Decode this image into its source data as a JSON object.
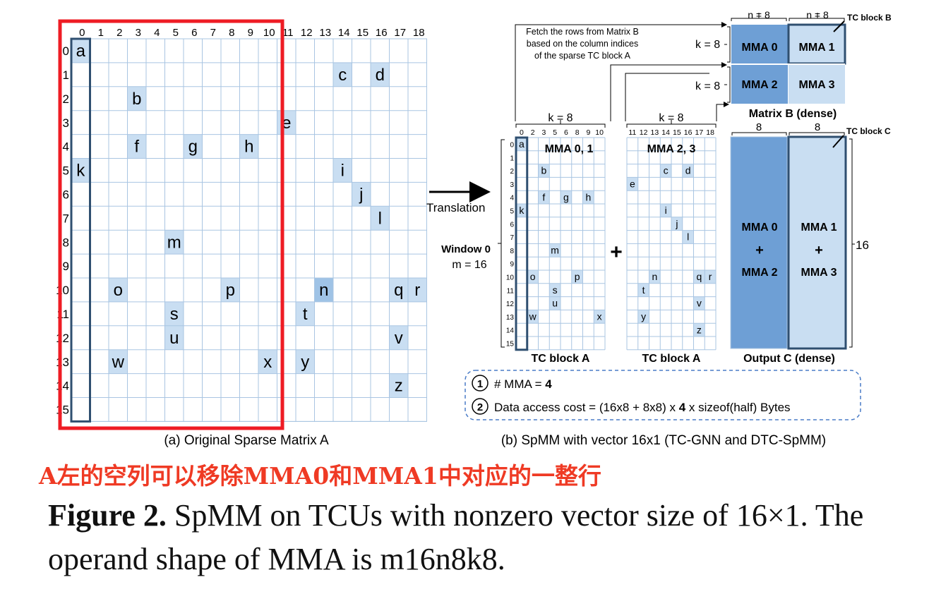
{
  "left": {
    "col_indices": [
      "0",
      "1",
      "2",
      "3",
      "4",
      "5",
      "6",
      "7",
      "8",
      "9",
      "10",
      "11",
      "12",
      "13",
      "14",
      "15",
      "16",
      "17",
      "18"
    ],
    "row_indices": [
      "0",
      "1",
      "2",
      "3",
      "4",
      "5",
      "6",
      "7",
      "8",
      "9",
      "10",
      "11",
      "12",
      "13",
      "14",
      "15"
    ],
    "letters": [
      "a",
      "b",
      "c",
      "d",
      "e",
      "f",
      "g",
      "h",
      "i",
      "j",
      "k",
      "l",
      "m",
      "n",
      "o",
      "p",
      "q",
      "r",
      "s",
      "t",
      "u",
      "v",
      "w",
      "x",
      "y",
      "z"
    ],
    "caption": "(a) Original Sparse Matrix A"
  },
  "arrow_label": "Translation",
  "window": {
    "title": "Window 0",
    "m": "m = 16"
  },
  "blockA1": {
    "k_label": "k = 8",
    "cols": [
      "0",
      "2",
      "3",
      "5",
      "6",
      "8",
      "9",
      "10"
    ],
    "title": "MMA 0, 1",
    "label": "TC block A"
  },
  "blockA2": {
    "k_label": "k = 8",
    "cols": [
      "11",
      "12",
      "13",
      "14",
      "15",
      "16",
      "17",
      "18"
    ],
    "title": "MMA 2, 3",
    "label": "TC block A"
  },
  "rows16": [
    "0",
    "1",
    "2",
    "3",
    "4",
    "5",
    "6",
    "7",
    "8",
    "9",
    "10",
    "11",
    "12",
    "13",
    "14",
    "15"
  ],
  "plus": "+",
  "fetch_note": [
    "Fetch the rows from Matrix B",
    "based on the column indices",
    "of the sparse TC block A"
  ],
  "matrixB": {
    "n_labels": [
      "n = 8",
      "n = 8"
    ],
    "k_labels": [
      "k = 8",
      "k = 8"
    ],
    "cells": [
      "MMA 0",
      "MMA 1",
      "MMA 2",
      "MMA 3"
    ],
    "title": "Matrix B (dense)",
    "tc_label": "TC block B"
  },
  "outputC": {
    "top_labels": [
      "8",
      "8"
    ],
    "tc_label": "TC block C",
    "left_text": [
      "MMA 0",
      "+",
      "MMA 2"
    ],
    "right_text": [
      "MMA 1",
      "+",
      "MMA 3"
    ],
    "side_label": "16",
    "title": "Output C (dense)"
  },
  "notes": {
    "n1": "1",
    "l1_pre": "# MMA = ",
    "l1_bold": "4",
    "n2": "2",
    "l2_pre": "Data access cost = (16x8 + 8x8) x ",
    "l2_bold": "4",
    "l2_post": " x sizeof(half) Bytes"
  },
  "right_caption": "(b) SpMM with vector 16x1 (TC-GNN and DTC-SpMM)",
  "chinese_note": "A左的空列可以移除MMA0和MMA1中对应的一整行",
  "figure_caption": {
    "label": "Figure 2.",
    "text": " SpMM on TCUs with nonzero vector size of 16×1. The operand shape of MMA is m16n8k8."
  },
  "colors": {
    "cell_light": "#c9def2",
    "cell_mid": "#9fc3e6",
    "cell_dark": "#6e9fd5",
    "border_dark": "#2f4f70",
    "grid": "#a9c5e2",
    "red_box": "#ee1c24",
    "note_red": "#ef3a24"
  }
}
